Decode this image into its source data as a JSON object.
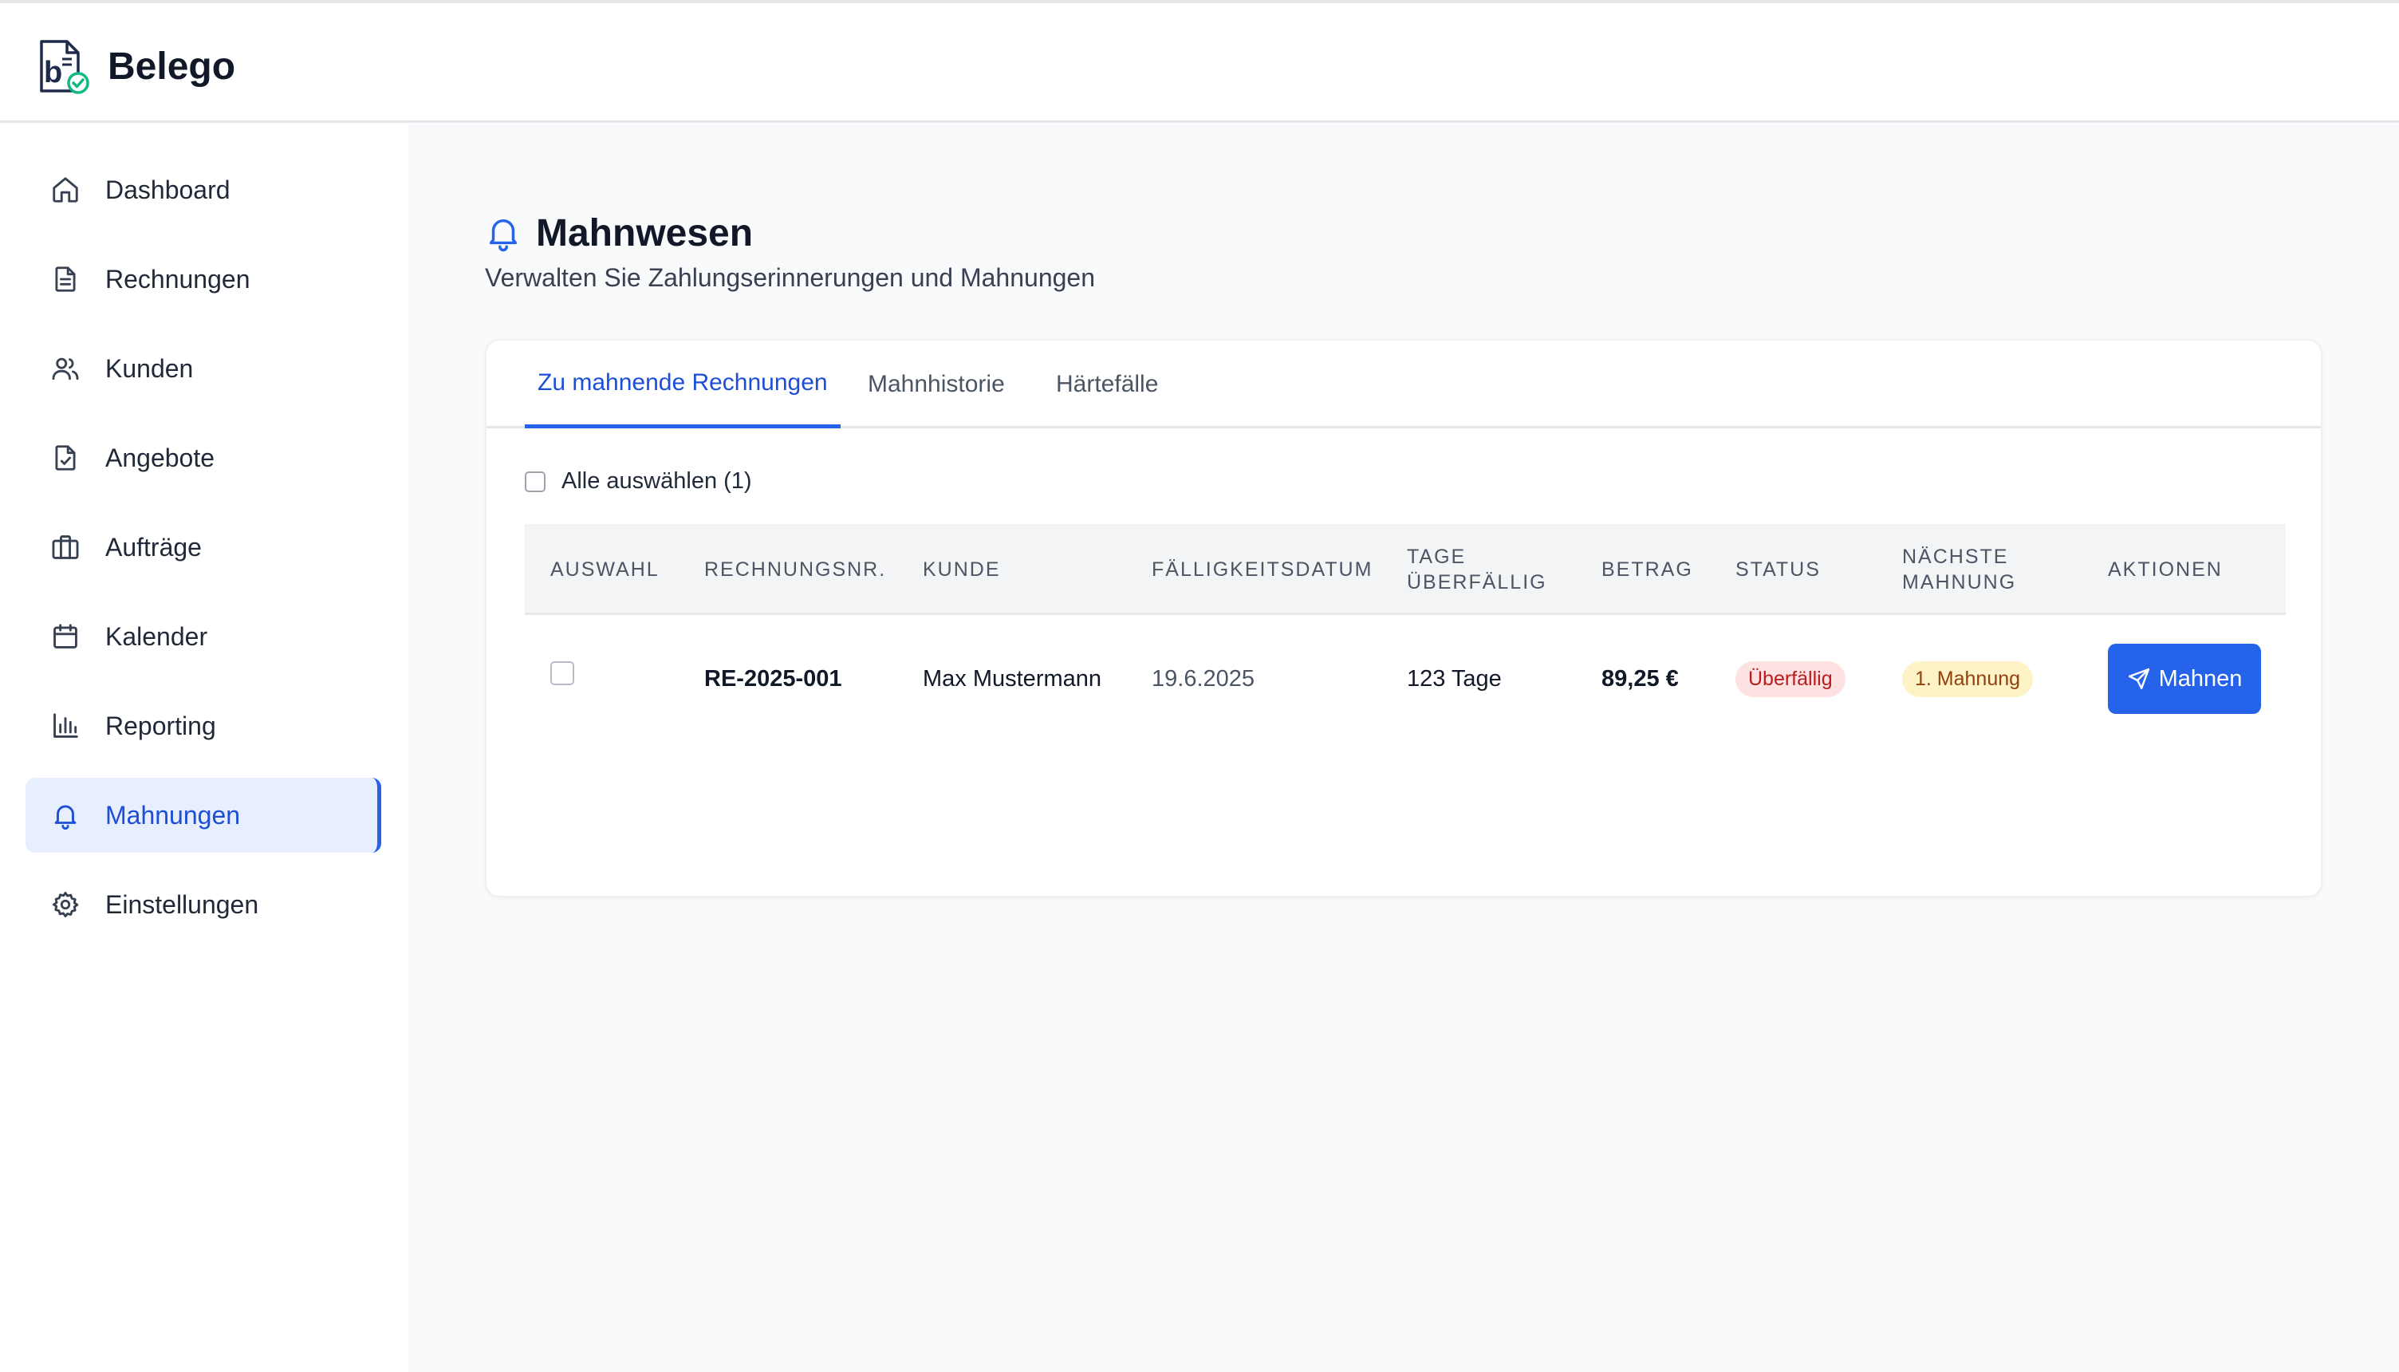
{
  "app": {
    "name": "Belego"
  },
  "colors": {
    "accent": "#2563eb",
    "danger": "#b91c1c",
    "warning": "#92400e"
  },
  "sidebar": {
    "items": [
      {
        "label": "Dashboard",
        "icon": "home-icon",
        "active": false
      },
      {
        "label": "Rechnungen",
        "icon": "document-icon",
        "active": false
      },
      {
        "label": "Kunden",
        "icon": "users-icon",
        "active": false
      },
      {
        "label": "Angebote",
        "icon": "document-check-icon",
        "active": false
      },
      {
        "label": "Aufträge",
        "icon": "briefcase-icon",
        "active": false
      },
      {
        "label": "Kalender",
        "icon": "calendar-icon",
        "active": false
      },
      {
        "label": "Reporting",
        "icon": "bar-chart-icon",
        "active": false
      },
      {
        "label": "Mahnungen",
        "icon": "bell-icon",
        "active": true
      },
      {
        "label": "Einstellungen",
        "icon": "gear-icon",
        "active": false
      }
    ]
  },
  "page": {
    "title": "Mahnwesen",
    "subtitle": "Verwalten Sie Zahlungserinnerungen und Mahnungen"
  },
  "tabs": [
    {
      "label": "Zu mahnende Rechnungen",
      "active": true
    },
    {
      "label": "Mahnhistorie",
      "active": false
    },
    {
      "label": "Härtefälle",
      "active": false
    }
  ],
  "select_all": {
    "label": "Alle auswählen (1)",
    "checked": false
  },
  "table": {
    "headers": {
      "auswahl": "AUSWAHL",
      "rechnungsnr": "RECHNUNGSNR.",
      "kunde": "KUNDE",
      "faelligkeit": "FÄLLIGKEITSDATUM",
      "tage_1": "TAGE",
      "tage_2": "ÜBERFÄLLIG",
      "betrag": "BETRAG",
      "status": "STATUS",
      "naechste_1": "NÄCHSTE",
      "naechste_2": "MAHNUNG",
      "aktionen": "AKTIONEN"
    },
    "rows": [
      {
        "checked": false,
        "rechnungsnr": "RE-2025-001",
        "kunde": "Max Mustermann",
        "faelligkeit": "19.6.2025",
        "tage": "123 Tage",
        "betrag": "89,25 €",
        "status": "Überfällig",
        "naechste": "1. Mahnung",
        "action": "Mahnen"
      }
    ]
  }
}
